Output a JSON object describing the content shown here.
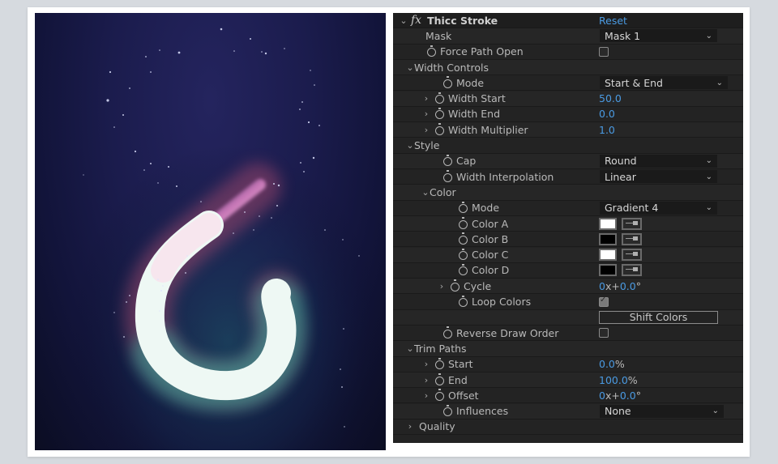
{
  "artwork": {
    "description": "glowing gradient stroke swirl on starfield",
    "background_color": "#1b1c4d"
  },
  "effect": {
    "name": "Thicc Stroke",
    "reset_label": "Reset",
    "rows": [
      {
        "label": "Mask",
        "type": "dropdown",
        "value": "Mask 1"
      },
      {
        "label": "Force Path Open",
        "type": "checkbox",
        "checked": false
      },
      {
        "label": "Width Controls",
        "type": "group"
      },
      {
        "label": "Mode",
        "type": "dropdown",
        "value": "Start & End"
      },
      {
        "label": "Width Start",
        "type": "number",
        "value": "50.0"
      },
      {
        "label": "Width End",
        "type": "number",
        "value": "0.0"
      },
      {
        "label": "Width Multiplier",
        "type": "number",
        "value": "1.0"
      },
      {
        "label": "Style",
        "type": "group"
      },
      {
        "label": "Cap",
        "type": "dropdown",
        "value": "Round"
      },
      {
        "label": "Width Interpolation",
        "type": "dropdown",
        "value": "Linear"
      },
      {
        "label": "Color",
        "type": "group"
      },
      {
        "label": "Mode",
        "type": "dropdown",
        "value": "Gradient 4"
      },
      {
        "label": "Color A",
        "type": "color",
        "value": "#ffffff"
      },
      {
        "label": "Color B",
        "type": "color",
        "value": "#000000"
      },
      {
        "label": "Color C",
        "type": "color",
        "value": "#ffffff"
      },
      {
        "label": "Color D",
        "type": "color",
        "value": "#000000"
      },
      {
        "label": "Cycle",
        "type": "angle",
        "rev": "0",
        "x": "x+",
        "deg": "0.0",
        "unit": "°"
      },
      {
        "label": "Loop Colors",
        "type": "checkbox",
        "checked": true
      },
      {
        "label": "",
        "type": "button",
        "value": "Shift Colors"
      },
      {
        "label": "Reverse Draw Order",
        "type": "checkbox",
        "checked": false
      },
      {
        "label": "Trim Paths",
        "type": "group"
      },
      {
        "label": "Start",
        "type": "percent",
        "value": "0.0",
        "unit": "%"
      },
      {
        "label": "End",
        "type": "percent",
        "value": "100.0",
        "unit": "%"
      },
      {
        "label": "Offset",
        "type": "angle",
        "rev": "0",
        "x": "x+",
        "deg": "0.0",
        "unit": "°"
      },
      {
        "label": "Influences",
        "type": "dropdown",
        "value": "None"
      },
      {
        "label": "Quality",
        "type": "group-collapsed"
      }
    ]
  },
  "icons": {
    "expanded": "⌄",
    "collapsed": "›",
    "dropdown_caret": "⌄",
    "fx": "fx"
  },
  "colors": {
    "accent_blue": "#4a9ae2",
    "panel_bg": "#232323"
  }
}
